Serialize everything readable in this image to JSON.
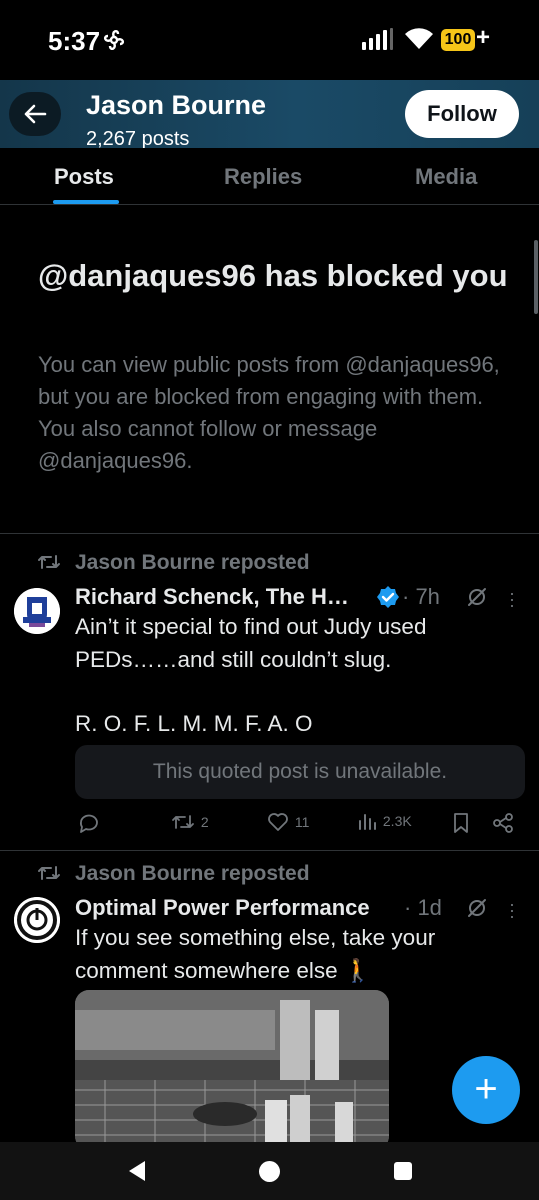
{
  "status_bar": {
    "time": "5:37",
    "battery": "100",
    "battery_suffix": "+"
  },
  "header": {
    "name": "Jason Bourne",
    "post_count": "2,267 posts",
    "follow_label": "Follow"
  },
  "tabs": [
    {
      "label": "Posts",
      "active": true
    },
    {
      "label": "Replies",
      "active": false
    },
    {
      "label": "Media",
      "active": false
    }
  ],
  "blocked": {
    "title": "@danjaques96 has blocked you",
    "description": "You can view public posts from @danjaques96, but you are blocked from engaging with them. You also cannot follow or message @danjaques96."
  },
  "posts": [
    {
      "repost_label": "Jason Bourne reposted",
      "author": "Richard Schenck, The H…",
      "verified": true,
      "time": "· 7h",
      "text_line1": "Ain’t it special to find out Judy used",
      "text_line2": "PEDs……and still couldn’t slug.",
      "text_line3": "R. O. F. L. M. M. F. A. O",
      "quote_text": "This quoted post is unavailable.",
      "actions": {
        "replies": "",
        "reposts": "2",
        "likes": "11",
        "views": "2.3K"
      }
    },
    {
      "repost_label": "Jason Bourne reposted",
      "author": "Optimal Power Performance",
      "time": "· 1d",
      "text_line1": "If you see something else, take your",
      "text_line2": "comment somewhere else 🚶"
    }
  ],
  "fab_label": "+",
  "colors": {
    "accent": "#1d9bf0",
    "muted": "#71767b",
    "text": "#e7e9ea",
    "background": "#000000"
  }
}
